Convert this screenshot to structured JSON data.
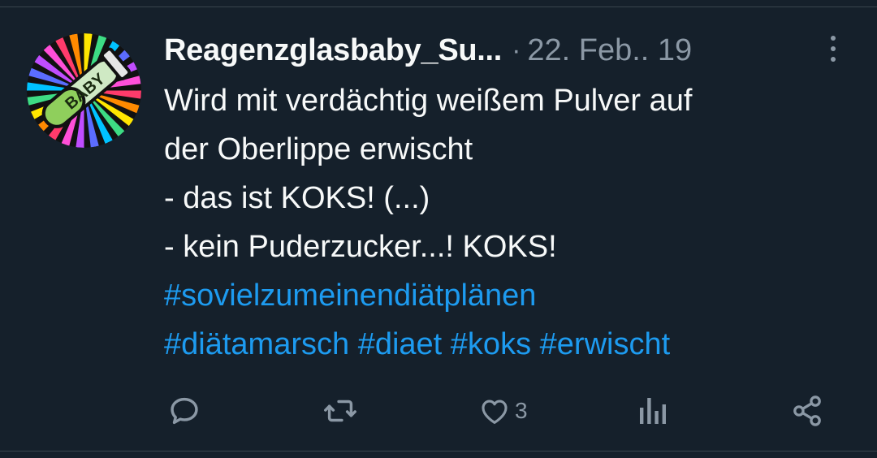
{
  "tweet": {
    "author": "Reagenzglasbaby_Su...",
    "separator": "·",
    "date": "22. Feb.. 19",
    "lines": [
      "Wird mit verdächtig weißem Pulver auf",
      "der Oberlippe erwischt",
      "- das ist KOKS! (...)",
      "- kein Puderzucker...! KOKS!"
    ],
    "hashtags_line1": [
      "#sovielzumeinendiätplänen"
    ],
    "hashtags_line2": [
      "#diätamarsch",
      "#diaet",
      "#koks",
      "#erwischt"
    ],
    "avatar_text": "BABY"
  },
  "actions": {
    "reply_count": "",
    "retweet_count": "",
    "like_count": "3",
    "views_count": ""
  },
  "colors": {
    "background": "#15202b",
    "text": "#f7f9f9",
    "muted": "#8b98a5",
    "link": "#1d9bf0",
    "divider": "#38444d"
  },
  "icons": [
    "more-options-icon",
    "reply-icon",
    "retweet-icon",
    "like-icon",
    "views-icon",
    "share-icon"
  ]
}
